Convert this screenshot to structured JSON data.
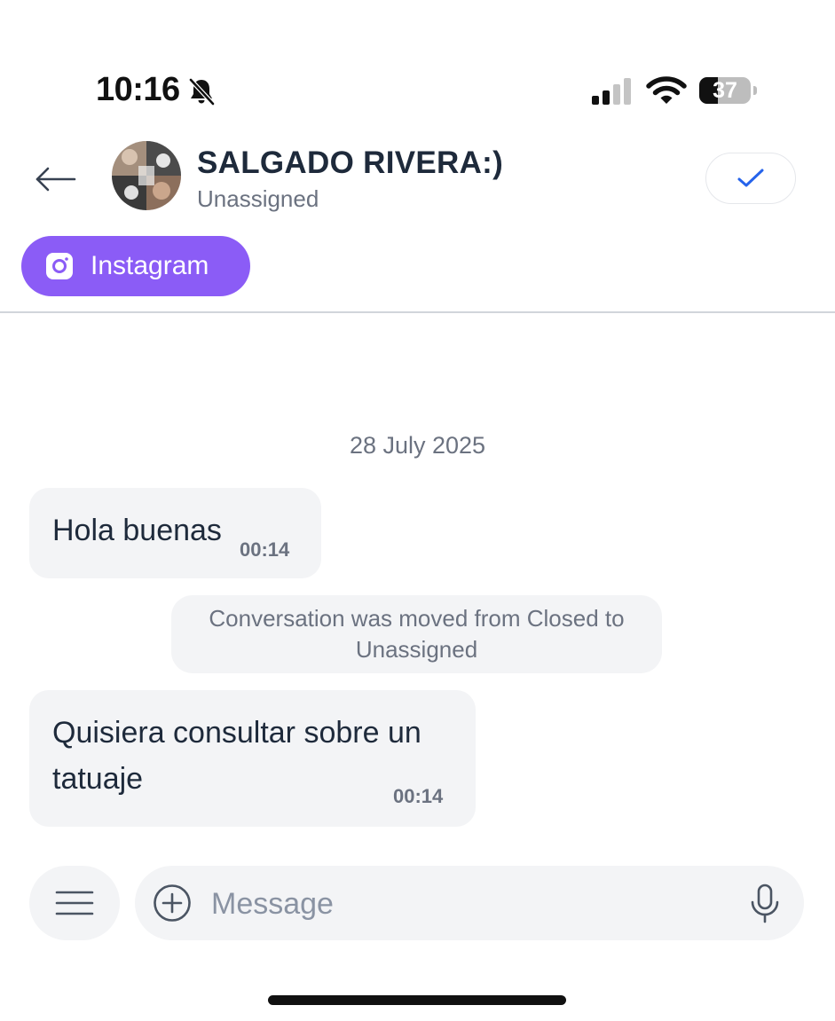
{
  "status_bar": {
    "time": "10:16",
    "battery_percent": "37",
    "battery_level": 0.37,
    "icons": [
      "bell-slash-icon",
      "cellular-signal-icon",
      "wifi-icon",
      "battery-icon"
    ]
  },
  "header": {
    "back_icon": "arrow-left-icon",
    "contact_name": "SALGADO RIVERA:)",
    "contact_status": "Unassigned",
    "resolve_icon": "check-icon",
    "channel": {
      "label": "Instagram",
      "icon": "instagram-icon",
      "color": "#8b5cf6"
    }
  },
  "conversation": {
    "date": "28 July 2025",
    "messages": [
      {
        "text": "Hola buenas",
        "time": "00:14"
      },
      {
        "text": "Quisiera consultar sobre un tatuaje",
        "time": "00:14"
      }
    ],
    "activity": "Conversation was moved from Closed to Unassigned"
  },
  "composer": {
    "menu_icon": "menu-icon",
    "attach_icon": "plus-circle-icon",
    "placeholder": "Message",
    "mic_icon": "microphone-icon"
  },
  "colors": {
    "accent": "#8b5cf6",
    "bubble": "#f3f4f6",
    "check": "#2563eb"
  }
}
